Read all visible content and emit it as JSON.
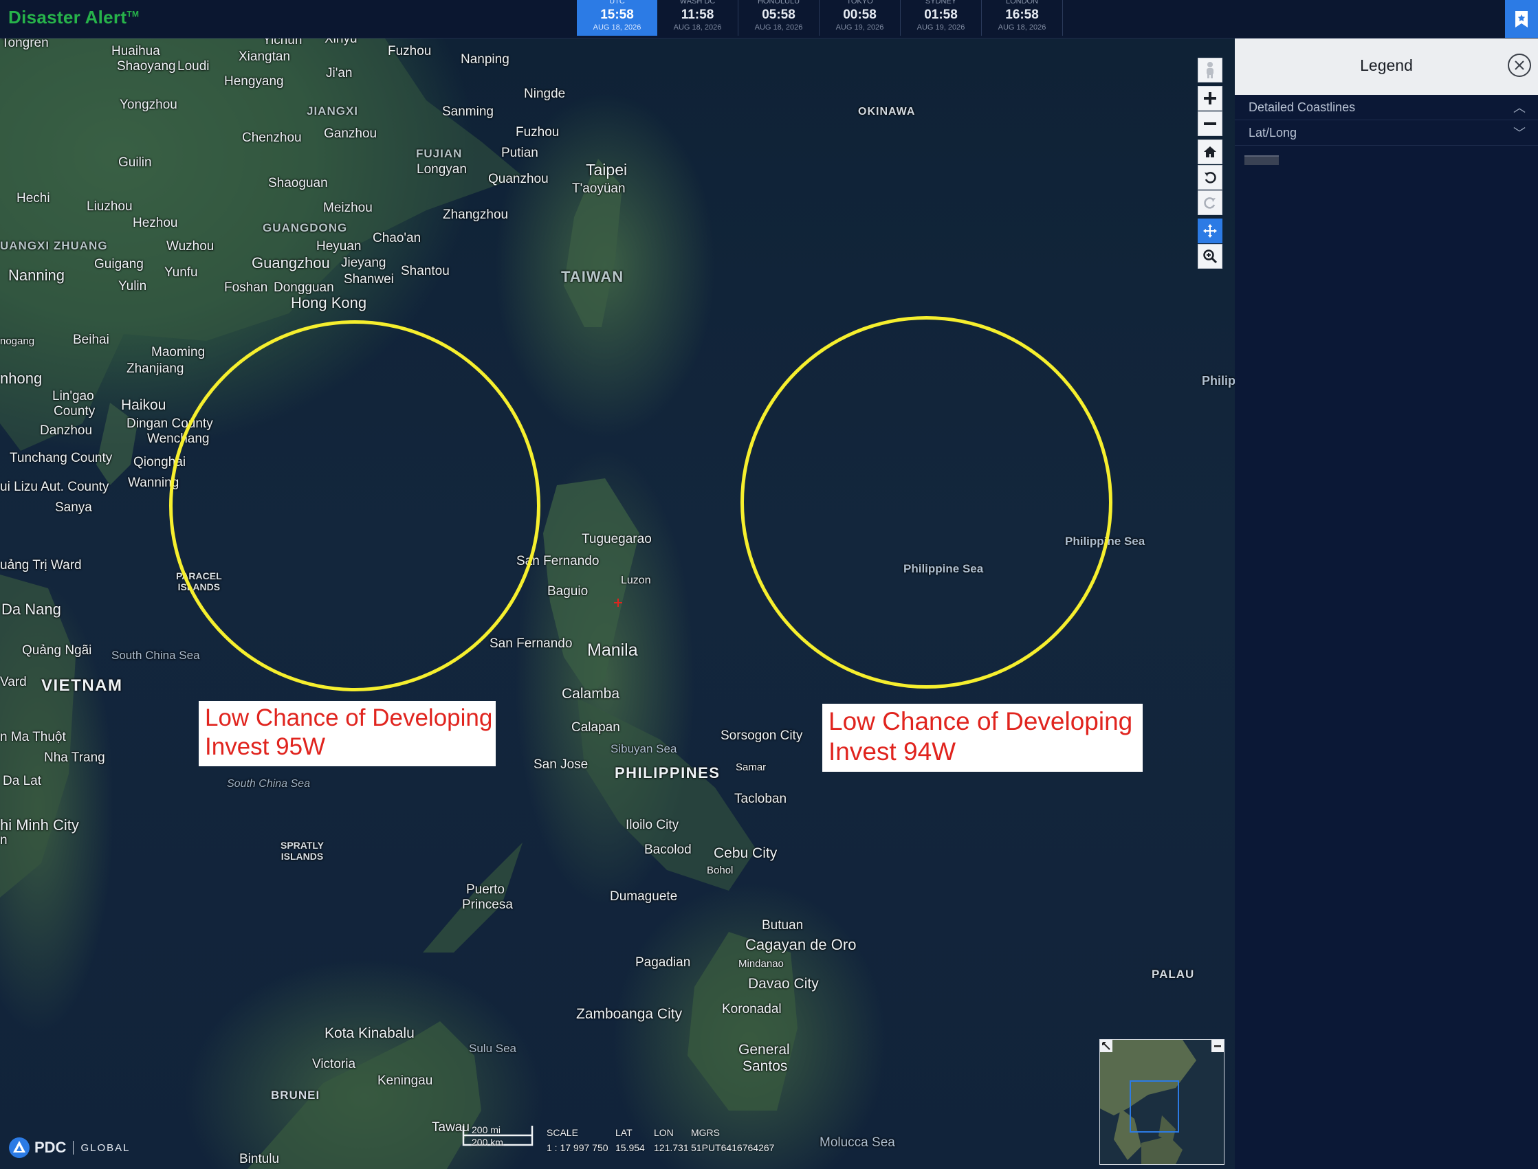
{
  "app": {
    "title": "Disaster Alert",
    "tm": "TM"
  },
  "clocks": [
    {
      "zone": "UTC",
      "time": "15:58",
      "date": "AUG 18, 2026",
      "active": true
    },
    {
      "zone": "WASH DC",
      "time": "11:58",
      "date": "AUG 18, 2026"
    },
    {
      "zone": "HONOLULU",
      "time": "05:58",
      "date": "AUG 18, 2026"
    },
    {
      "zone": "TOKYO",
      "time": "00:58",
      "date": "AUG 19, 2026"
    },
    {
      "zone": "SYDNEY",
      "time": "01:58",
      "date": "AUG 19, 2026"
    },
    {
      "zone": "LONDON",
      "time": "16:58",
      "date": "AUG 18, 2026"
    }
  ],
  "legend": {
    "title": "Legend",
    "rows": [
      {
        "label": "Detailed Coastlines",
        "chevron": "︿"
      },
      {
        "label": "Lat/Long",
        "chevron": "﹀"
      }
    ]
  },
  "annotations": {
    "left": {
      "line1": "Low Chance of Developing",
      "line2": "Invest 95W"
    },
    "right": {
      "line1": "Low Chance of Developing",
      "line2": "Invest 94W"
    }
  },
  "places": {
    "tongren": "Tongren",
    "huaihua": "Huaihua",
    "xiangtan": "Xiangtan",
    "yichun": "Yichun",
    "xinyu": "Xinyu",
    "fuzhou_n": "Fuzhou",
    "nanping": "Nanping",
    "shaoyang": "Shaoyang",
    "loudi": "Loudi",
    "jian": "Ji'an",
    "hengyang": "Hengyang",
    "ningde": "Ningde",
    "yongzhou": "Yongzhou",
    "jiangxi": "JIANGXI",
    "sanming": "Sanming",
    "fuzhou": "Fuzhou",
    "chenzhou": "Chenzhou",
    "ganzhou": "Ganzhou",
    "putian": "Putian",
    "fujian": "FUJIAN",
    "guilin": "Guilin",
    "longyan": "Longyan",
    "quanzhou": "Quanzhou",
    "taipei": "Taipei",
    "taoyuan": "T'aoyüan",
    "shaoguan": "Shaoguan",
    "hechi": "Hechi",
    "liuzhou": "Liuzhou",
    "meizhou": "Meizhou",
    "zhangzhou": "Zhangzhou",
    "hezhou": "Hezhou",
    "guangdong": "GUANGDONG",
    "chaoan": "Chao'an",
    "guangxi": "UANGXI ZHUANG",
    "wuzhou": "Wuzhou",
    "heyuan": "Heyuan",
    "guigang": "Guigang",
    "guangzhou": "Guangzhou",
    "jieyang": "Jieyang",
    "shantou": "Shantou",
    "nanning": "Nanning",
    "yunfu": "Yunfu",
    "shanwei": "Shanwei",
    "taiwan": "TAIWAN",
    "yulin": "Yulin",
    "foshan": "Foshan",
    "dongguan": "Dongguan",
    "hongkong": "Hong Kong",
    "okinawa": "OKINAWA",
    "beihai": "Beihai",
    "fangcheng": "nogang",
    "maoming": "Maoming",
    "zhanjiang": "Zhanjiang",
    "nhong": "nhong",
    "lingao": "Lin'gao",
    "lingao2": "County",
    "haikou": "Haikou",
    "dingan": "Dingan County",
    "danzhou": "Danzhou",
    "wenchang": "Wenchang",
    "tunchang": "Tunchang County",
    "qionghai": "Qionghai",
    "lizu": "ui Lizu Aut. County",
    "wanning": "Wanning",
    "sanya": "Sanya",
    "philip_edge": "Philip",
    "tuguegarao": "Tuguegarao",
    "sanfernando1": "San Fernando",
    "luzon": "Luzon",
    "baguio": "Baguio",
    "philsea1": "Philippine Sea",
    "philsea2": "Philippine Sea",
    "quangtri": "uảng Trị Ward",
    "paracel1": "PARACEL",
    "paracel2": "ISLANDS",
    "danang": "Da Nang",
    "sanfernando2": "San Fernando",
    "manila": "Manila",
    "quangngai": "Quảng Ngãi",
    "scs1": "South China Sea",
    "vard": "Vard",
    "vietnam": "VIETNAM",
    "calamba": "Calamba",
    "calapan": "Calapan",
    "sorsogon": "Sorsogon City",
    "nmathuot": "n Ma Thuột",
    "nhatrang": "Nha Trang",
    "sibuyan": "Sibuyan Sea",
    "sanjose": "San Jose",
    "philippines": "PHILIPPINES",
    "samar": "Samar",
    "dalat": "Da Lat",
    "scs2": "South China Sea",
    "tacloban": "Tacloban",
    "hcmc": "hi Minh City",
    "hcmc2": "n",
    "iloilo": "Iloilo City",
    "bacolod": "Bacolod",
    "cebu": "Cebu City",
    "spratly1": "SPRATLY",
    "spratly2": "ISLANDS",
    "bohol": "Bohol",
    "dumaguete": "Dumaguete",
    "puerto": "Puerto",
    "princesa": "Princesa",
    "butuan": "Butuan",
    "cdo": "Cagayan de Oro",
    "pagadian": "Pagadian",
    "mindanao": "Mindanao",
    "palau": "PALAU",
    "davao": "Davao City",
    "koronadal": "Koronadal",
    "zamboanga": "Zamboanga City",
    "kotakinabalu": "Kota Kinabalu",
    "sulu": "Sulu Sea",
    "general1": "General",
    "general2": "Santos",
    "victoria": "Victoria",
    "keningau": "Keningau",
    "brunei": "BRUNEI",
    "tawau": "Tawau",
    "bintulu": "Bintulu",
    "molucca": "Molucca Sea"
  },
  "scale": {
    "mi": "200 mi",
    "km": "200 km"
  },
  "status": {
    "scale_label": "SCALE",
    "scale_value": "1 : 17 997 750",
    "lat_label": "LAT",
    "lat_value": "15.954",
    "lon_label": "LON",
    "lon_value": "121.731",
    "mgrs_label": "MGRS",
    "mgrs_value": "51PUT6416764267"
  },
  "logo": {
    "brand": "PDC",
    "tagline": "GLOBAL"
  },
  "icons": [
    "pegman-icon",
    "zoom-in-icon",
    "zoom-out-icon",
    "home-icon",
    "rotate-left-icon",
    "rotate-right-icon",
    "pan-icon",
    "zoom-box-icon",
    "close-icon",
    "bookmark-icon"
  ],
  "colors": {
    "accent": "#2c7be5",
    "brand_green": "#27b34a",
    "circle": "#f6ef2e",
    "annotation_text": "#e0241e"
  }
}
